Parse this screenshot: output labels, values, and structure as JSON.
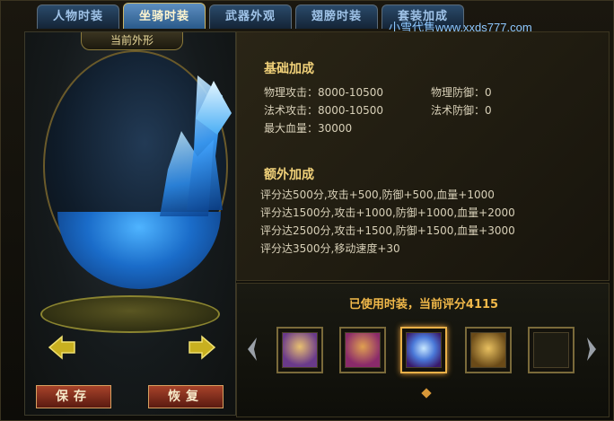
{
  "tabs": [
    {
      "label": "人物时装"
    },
    {
      "label": "坐骑时装",
      "active": true
    },
    {
      "label": "武器外观"
    },
    {
      "label": "翅膀时装"
    },
    {
      "label": "套装加成"
    }
  ],
  "watermark": "小雪代售www.xxds777.com",
  "left": {
    "title": "当前外形",
    "save_label": "保存",
    "restore_label": "恢复"
  },
  "base": {
    "title": "基础加成",
    "phys_atk": "物理攻击：8000-10500",
    "phys_def": "物理防御：0",
    "magic_atk": "法术攻击：8000-10500",
    "magic_def": "法术防御：0",
    "max_hp": "最大血量：30000"
  },
  "extra": {
    "title": "额外加成",
    "lines": [
      "评分达500分,攻击+500,防御+500,血量+1000",
      "评分达1500分,攻击+1000,防御+1000,血量+2000",
      "评分达2500分,攻击+1500,防御+1500,血量+3000",
      "评分达3500分,移动速度+30"
    ]
  },
  "equip": {
    "title": "已使用时装，当前评分4115",
    "slots": [
      {
        "icon": "mount-dragon-icon"
      },
      {
        "icon": "mount-beast-icon"
      },
      {
        "icon": "crystal-orb-icon",
        "selected": true
      },
      {
        "icon": "golden-mount-icon"
      },
      {
        "icon": "empty-slot"
      }
    ]
  },
  "colors": {
    "accent": "#f2d27a",
    "tab_active": "#5d8ec0",
    "button": "#a8432a"
  }
}
